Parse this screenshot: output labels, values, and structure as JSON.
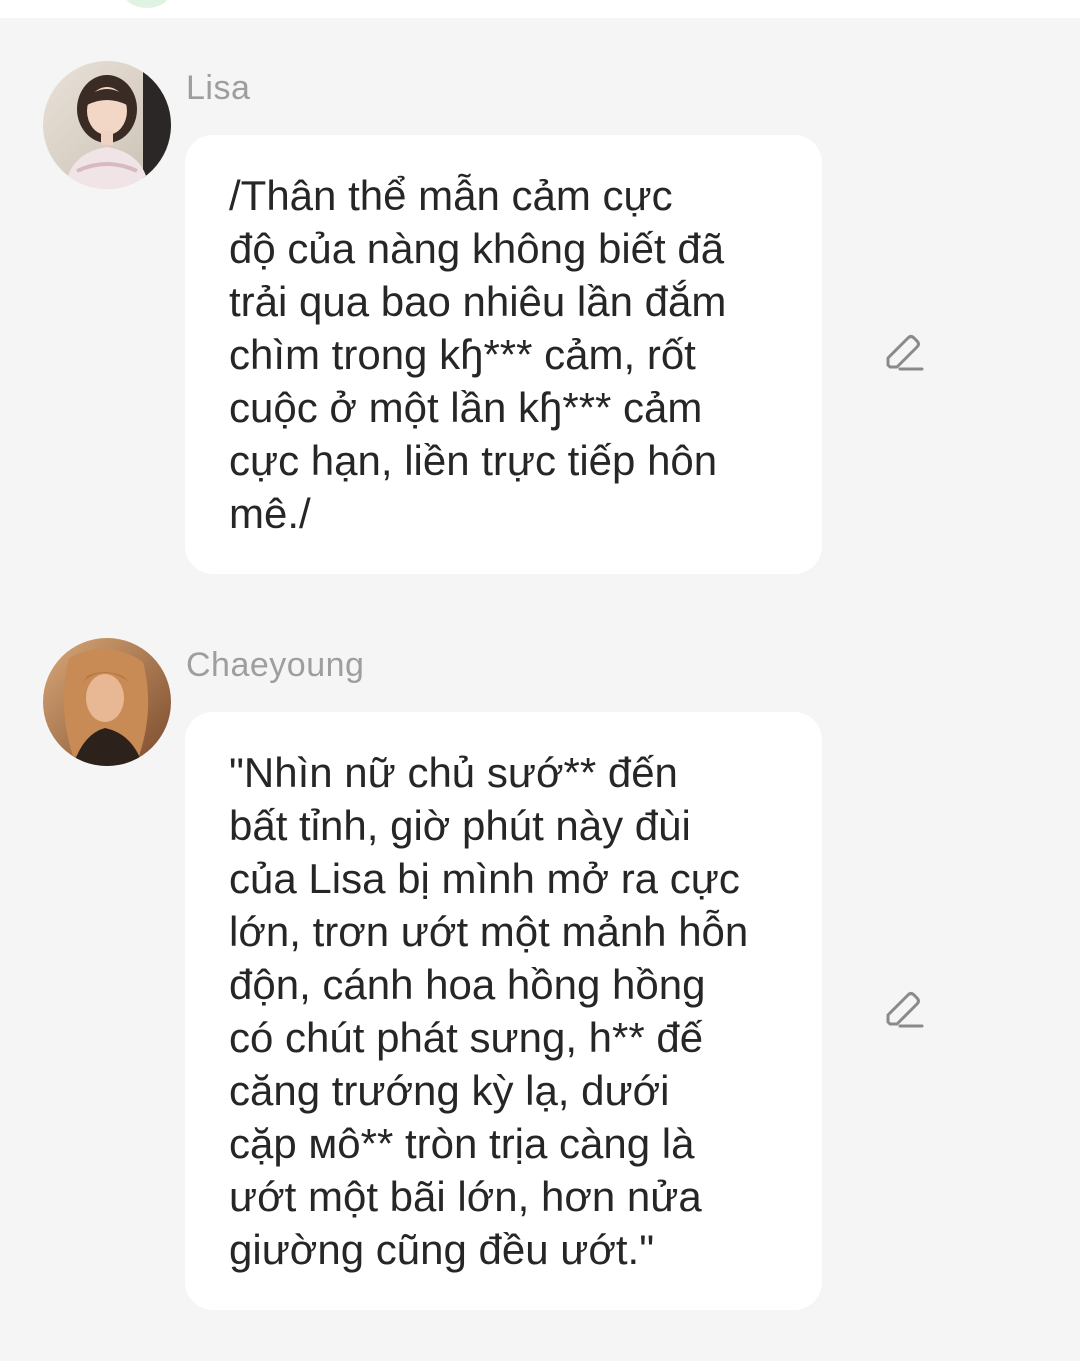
{
  "messages": [
    {
      "sender": "Lisa",
      "avatar": "lisa-avatar",
      "text": "/Thân thể mẫn cảm cực\nđộ của nàng không biết đã\ntrải qua bao nhiêu lần đắm\nchìm trong kɧ*** cảm, rốt\ncuộc ở một lần kɧ*** cảm\ncực hạn, liền trực tiếp hôn\nmê./",
      "edit_icon": "pencil-edit-icon"
    },
    {
      "sender": "Chaeyoung",
      "avatar": "chaeyoung-avatar",
      "text": "\"Nhìn nữ chủ sướ** đến\nbất tỉnh, giờ phút này đùi\ncủa Lisa bị mình mở ra cực\nlớn, trơn ướt một mảnh hỗn\nđộn, cánh hoa hồng hồng\ncó chút phát sưng, h** đế\ncăng trướng kỳ lạ, dưới\ncặp мô** tròn trịa càng là\nướt một bãi lớn, hơn nửa\ngiường cũng đều ướt.\"",
      "edit_icon": "pencil-edit-icon"
    }
  ],
  "colors": {
    "background": "#f5f5f5",
    "bubble": "#ffffff",
    "sender_name": "#9e9e9e",
    "message_text": "#262626",
    "icon": "#8a8a8a"
  }
}
